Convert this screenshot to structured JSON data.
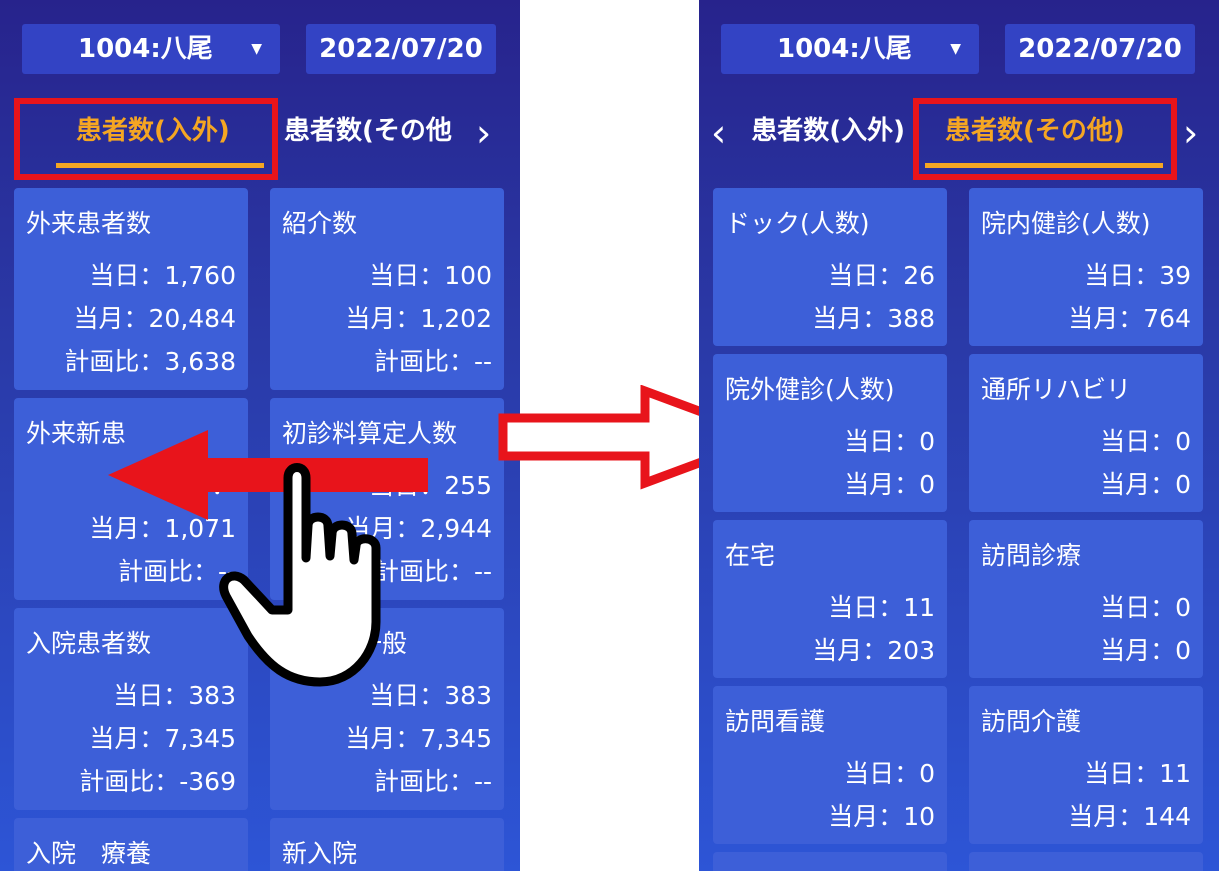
{
  "left_screen": {
    "patient_label": "1004:八尾",
    "date": "2022/07/20",
    "tabs": [
      "患者数(入外)",
      "患者数(その他"
    ],
    "cards": [
      {
        "title": "外来患者数",
        "rows": [
          "当日：1,760",
          "当月：20,484",
          "計画比：3,638"
        ]
      },
      {
        "title": "紹介数",
        "rows": [
          "当日：100",
          "当月：1,202",
          "計画比：--"
        ]
      },
      {
        "title": "外来新患",
        "rows": [
          "当日：",
          "当月：1,071",
          "計画比：--"
        ]
      },
      {
        "title": "初診料算定人数",
        "rows": [
          "当日：255",
          "当月：2,944",
          "計画比：--"
        ]
      },
      {
        "title": "入院患者数",
        "rows": [
          "当日：383",
          "当月：7,345",
          "計画比：-369"
        ]
      },
      {
        "title": "入院　一般",
        "rows": [
          "当日：383",
          "当月：7,345",
          "計画比：--"
        ]
      },
      {
        "title": "入院　療養",
        "rows": []
      },
      {
        "title": "新入院",
        "rows": []
      }
    ]
  },
  "right_screen": {
    "patient_label": "1004:八尾",
    "date": "2022/07/20",
    "tabs": [
      "患者数(入外)",
      "患者数(その他)"
    ],
    "cards": [
      {
        "title": "ドック(人数)",
        "rows": [
          "当日：26",
          "当月：388"
        ]
      },
      {
        "title": "院内健診(人数)",
        "rows": [
          "当日：39",
          "当月：764"
        ]
      },
      {
        "title": "院外健診(人数)",
        "rows": [
          "当日：0",
          "当月：0"
        ]
      },
      {
        "title": "通所リハビリ",
        "rows": [
          "当日：0",
          "当月：0"
        ]
      },
      {
        "title": "在宅",
        "rows": [
          "当日：11",
          "当月：203"
        ]
      },
      {
        "title": "訪問診療",
        "rows": [
          "当日：0",
          "当月：0"
        ]
      },
      {
        "title": "訪問看護",
        "rows": [
          "当日：0",
          "当月：10"
        ]
      },
      {
        "title": "訪問介護",
        "rows": [
          "当日：11",
          "当月：144"
        ]
      }
    ]
  },
  "icons": {
    "dropdown": "caret-down-icon",
    "tab_prev": "chevron-left-icon",
    "tab_next": "chevron-right-icon",
    "gesture": "hand-swipe-left-icon",
    "transition": "arrow-right-icon"
  },
  "colors": {
    "active_tab": "#f5a623",
    "highlight": "#e8141b",
    "card": "#3d5fd8",
    "control": "#3343c4"
  }
}
